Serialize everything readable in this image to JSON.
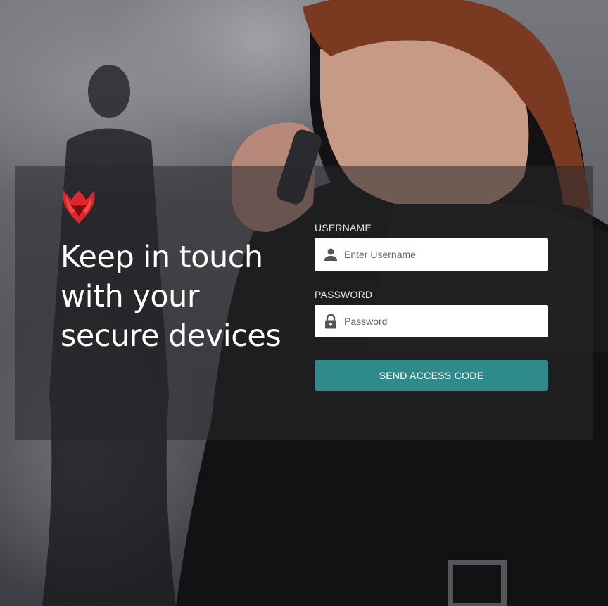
{
  "brand": {
    "logo_icon": "fox-emblem-icon",
    "logo_color": "#e0262b"
  },
  "hero": {
    "headline": "Keep in touch with your secure devices"
  },
  "login_form": {
    "username": {
      "label": "USERNAME",
      "placeholder": "Enter Username",
      "value": "",
      "icon": "person-icon"
    },
    "password": {
      "label": "PASSWORD",
      "placeholder": "Password",
      "value": "",
      "icon": "lock-icon"
    },
    "submit_label": "SEND ACCESS CODE",
    "accent_color": "#2f8a8c"
  }
}
